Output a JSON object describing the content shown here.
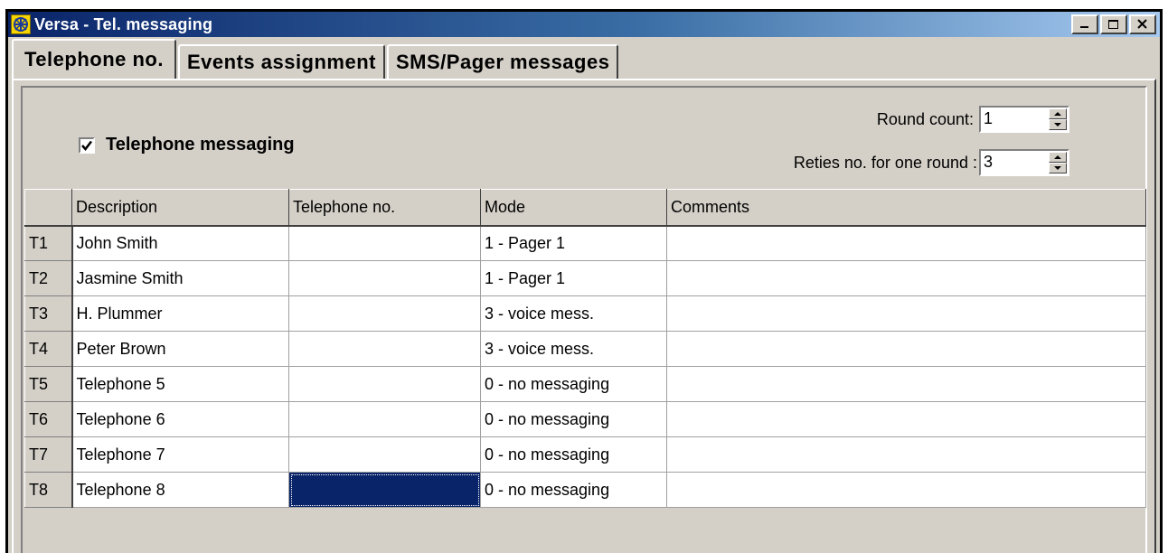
{
  "window": {
    "title": "Versa - Tel. messaging"
  },
  "tabs": [
    {
      "label": "Telephone no."
    },
    {
      "label": "Events assignment"
    },
    {
      "label": "SMS/Pager messages"
    }
  ],
  "options": {
    "telephone_messaging_label": "Telephone messaging",
    "telephone_messaging_checked": true,
    "round_count_label": "Round count:",
    "round_count_value": "1",
    "retries_label": "Reties no. for one round :",
    "retries_value": "3"
  },
  "grid": {
    "columns": [
      "",
      "Description",
      "Telephone no.",
      "Mode",
      "Comments"
    ],
    "rows": [
      {
        "id": "T1",
        "description": "John Smith",
        "telephone": "",
        "mode": "1 - Pager 1",
        "comments": ""
      },
      {
        "id": "T2",
        "description": "Jasmine Smith",
        "telephone": "",
        "mode": "1 - Pager 1",
        "comments": ""
      },
      {
        "id": "T3",
        "description": "H. Plummer",
        "telephone": "",
        "mode": "3 - voice mess.",
        "comments": ""
      },
      {
        "id": "T4",
        "description": "Peter Brown",
        "telephone": "",
        "mode": "3 - voice mess.",
        "comments": ""
      },
      {
        "id": "T5",
        "description": "Telephone 5",
        "telephone": "",
        "mode": "0 - no messaging",
        "comments": ""
      },
      {
        "id": "T6",
        "description": "Telephone 6",
        "telephone": "",
        "mode": "0 - no messaging",
        "comments": ""
      },
      {
        "id": "T7",
        "description": "Telephone 7",
        "telephone": "",
        "mode": "0 - no messaging",
        "comments": ""
      },
      {
        "id": "T8",
        "description": "Telephone 8",
        "telephone": "",
        "mode": "0 - no messaging",
        "comments": ""
      }
    ]
  }
}
